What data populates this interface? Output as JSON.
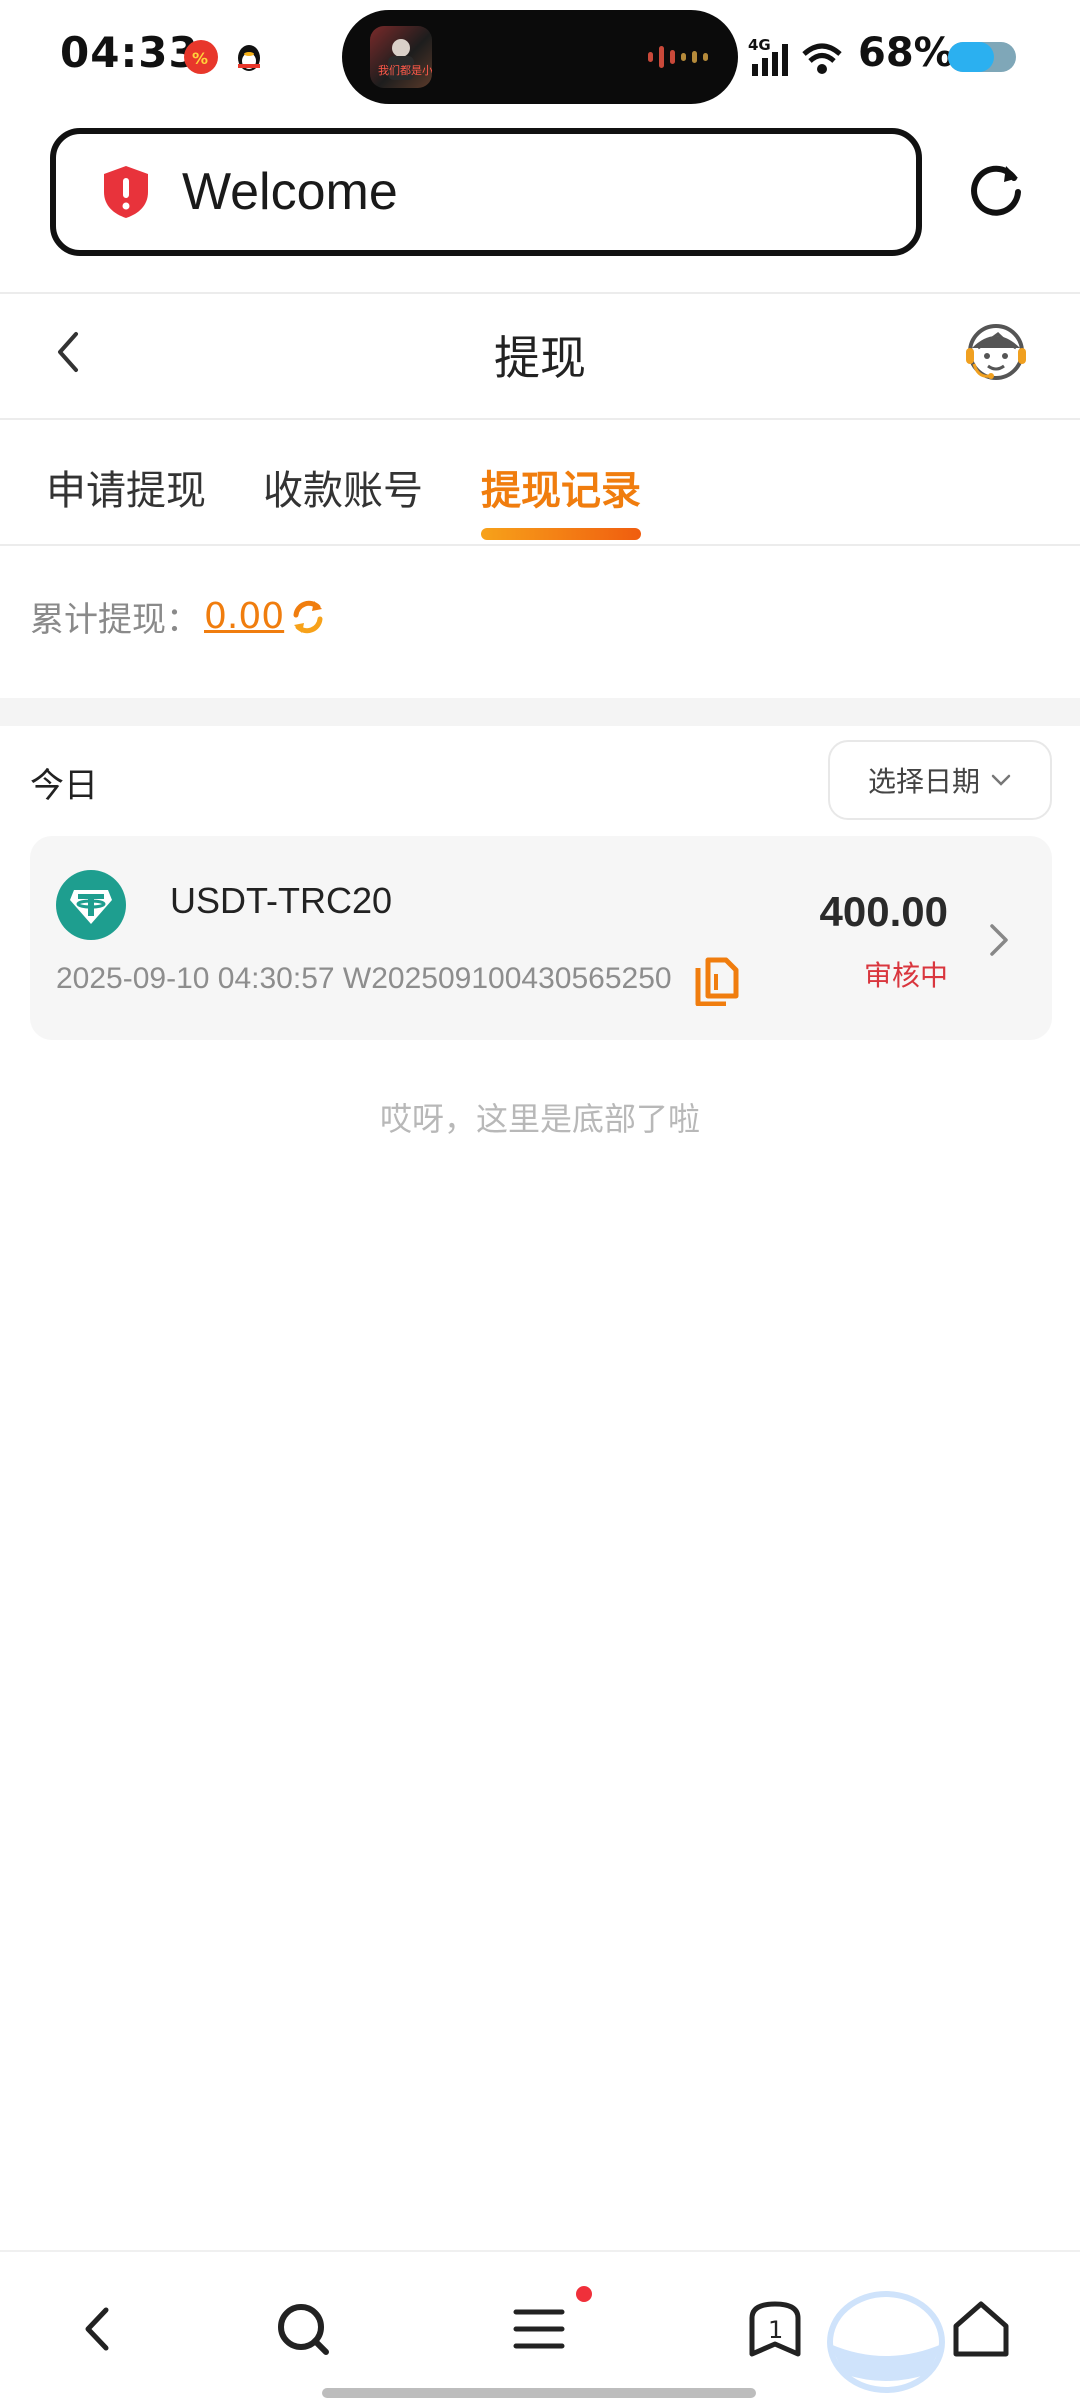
{
  "status_bar": {
    "time": "04:33",
    "network": "4G",
    "battery": "68%",
    "battery_level": 0.68,
    "notification_icons": [
      "app-notification-icon",
      "qq-penguin-icon"
    ],
    "island_thumb_text": "我们都是小行仔"
  },
  "browser": {
    "address_text": "Welcome",
    "security_icon": "shield-alert-icon",
    "reload_icon": "reload-icon"
  },
  "header": {
    "title": "提现",
    "back_icon": "back-arrow-icon",
    "service_icon": "customer-service-icon"
  },
  "tabs": [
    {
      "label": "申请提现",
      "active": false
    },
    {
      "label": "收款账号",
      "active": false
    },
    {
      "label": "提现记录",
      "active": true
    }
  ],
  "summary": {
    "label": "累计提现：",
    "value": "0.00"
  },
  "section": {
    "label": "今日",
    "date_picker": "选择日期"
  },
  "records": [
    {
      "coin": "USDT-TRC20",
      "datetime": "2025-09-10 04:30:57",
      "order_id": "W202509100430565250",
      "amount": "400.00",
      "status": "审核中"
    }
  ],
  "end_note": "哎呀，这里是底部了啦",
  "nav": {
    "items": [
      "back-icon",
      "search-icon",
      "menu-icon",
      "tabs-icon",
      "home-icon"
    ],
    "tab_count": "1"
  },
  "colors": {
    "accent": "#f07d0e",
    "status_pending": "#d9363e",
    "tether": "#1e9e8f"
  }
}
